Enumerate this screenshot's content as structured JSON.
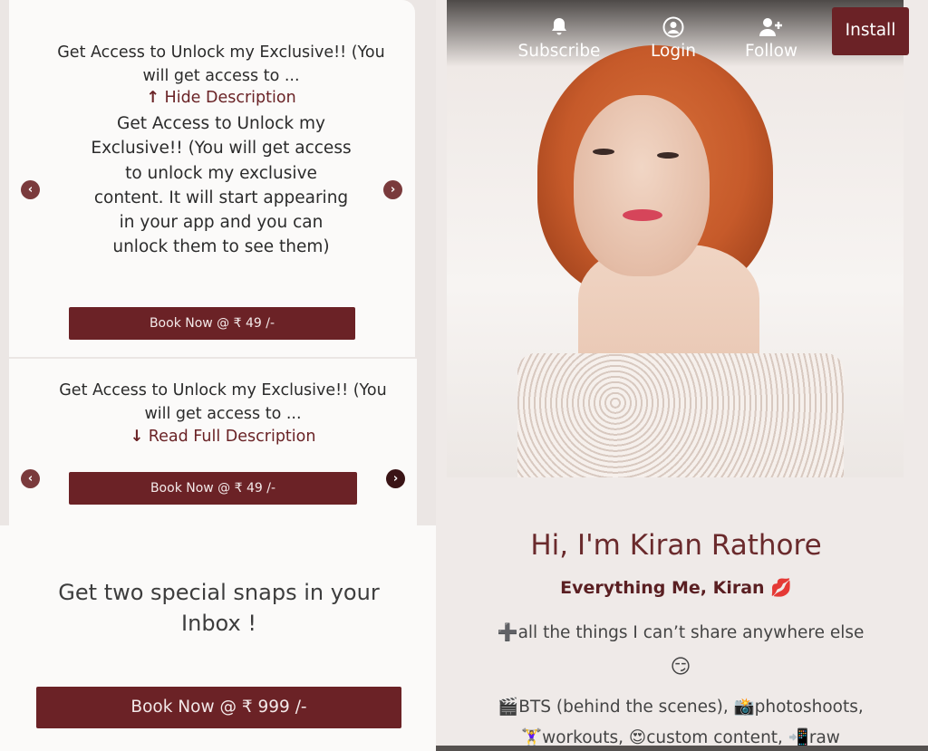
{
  "left_panel": {
    "card1": {
      "snippet": "Get Access to Unlock my Exclusive!! (You will get access to ...",
      "toggle_arrow": "↑",
      "toggle_label": "Hide Description",
      "full_description": "Get Access to Unlock my Exclusive!! (You will get access to unlock my exclusive content. It will start appearing in your app and you can unlock them to see them)",
      "prev_icon": "‹",
      "next_icon": "›",
      "button_label": "Book Now @ ₹ 49 /-"
    },
    "card2": {
      "snippet": "Get Access to Unlock my Exclusive!! (You will get access to ...",
      "toggle_arrow": "↓",
      "toggle_label": "Read Full Description",
      "prev_icon": "‹",
      "next_icon": "›",
      "button_label": "Book Now @ ₹ 49 /-"
    },
    "card3": {
      "title": "Get two special snaps in your Inbox !",
      "button_label": "Book Now @ ₹ 999 /-"
    }
  },
  "right_panel": {
    "nav": {
      "subscribe": "Subscribe",
      "login": "Login",
      "follow": "Follow",
      "install": "Install"
    },
    "profile": {
      "name": "Hi, I'm Kiran Rathore",
      "tagline": "Everything Me, Kiran 💋",
      "bio_line1": "➕all the things I can’t share anywhere else",
      "bio_line2": "😏",
      "bio_line3": "🎬BTS (behind the scenes), 📸photoshoots,",
      "bio_line4": "🏋️‍♀️workouts, 😍custom content, 📲raw"
    }
  },
  "colors": {
    "accent": "#6b2226",
    "heading": "#6a2a2c",
    "panel_bg": "#fbfaf9"
  }
}
